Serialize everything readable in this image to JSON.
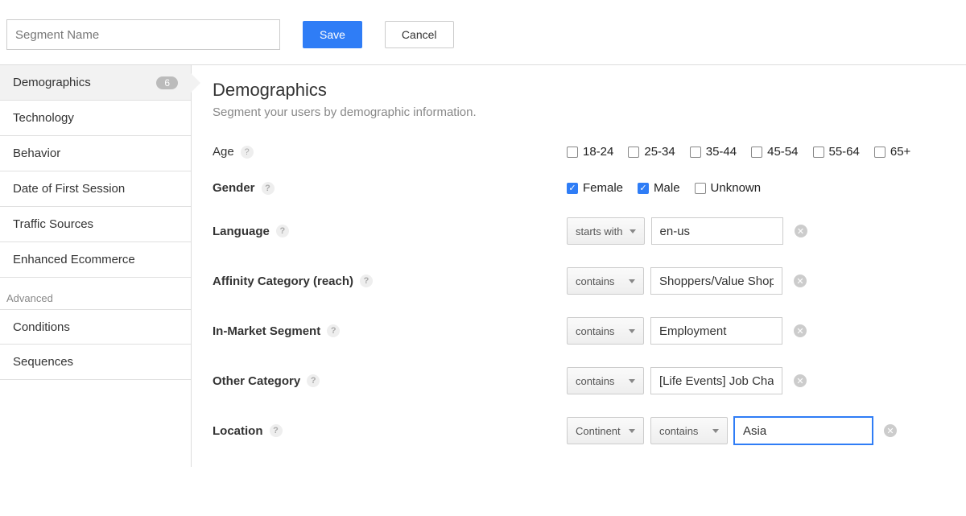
{
  "header": {
    "segment_name_placeholder": "Segment Name",
    "save_label": "Save",
    "cancel_label": "Cancel"
  },
  "sidebar": {
    "items": [
      {
        "label": "Demographics",
        "badge": "6"
      },
      {
        "label": "Technology"
      },
      {
        "label": "Behavior"
      },
      {
        "label": "Date of First Session"
      },
      {
        "label": "Traffic Sources"
      },
      {
        "label": "Enhanced Ecommerce"
      }
    ],
    "advanced_header": "Advanced",
    "advanced_items": [
      {
        "label": "Conditions"
      },
      {
        "label": "Sequences"
      }
    ]
  },
  "main": {
    "title": "Demographics",
    "subtitle": "Segment your users by demographic information.",
    "age": {
      "label": "Age",
      "options": [
        "18-24",
        "25-34",
        "35-44",
        "45-54",
        "55-64",
        "65+"
      ]
    },
    "gender": {
      "label": "Gender",
      "options": [
        {
          "label": "Female",
          "checked": true
        },
        {
          "label": "Male",
          "checked": true
        },
        {
          "label": "Unknown",
          "checked": false
        }
      ]
    },
    "language": {
      "label": "Language",
      "operator": "starts with",
      "value": "en-us"
    },
    "affinity": {
      "label": "Affinity Category (reach)",
      "operator": "contains",
      "value": "Shoppers/Value Shop"
    },
    "inmarket": {
      "label": "In-Market Segment",
      "operator": "contains",
      "value": "Employment"
    },
    "other": {
      "label": "Other Category",
      "operator": "contains",
      "value": "[Life Events] Job Chan"
    },
    "location": {
      "label": "Location",
      "dimension": "Continent",
      "operator": "contains",
      "value": "Asia"
    }
  }
}
